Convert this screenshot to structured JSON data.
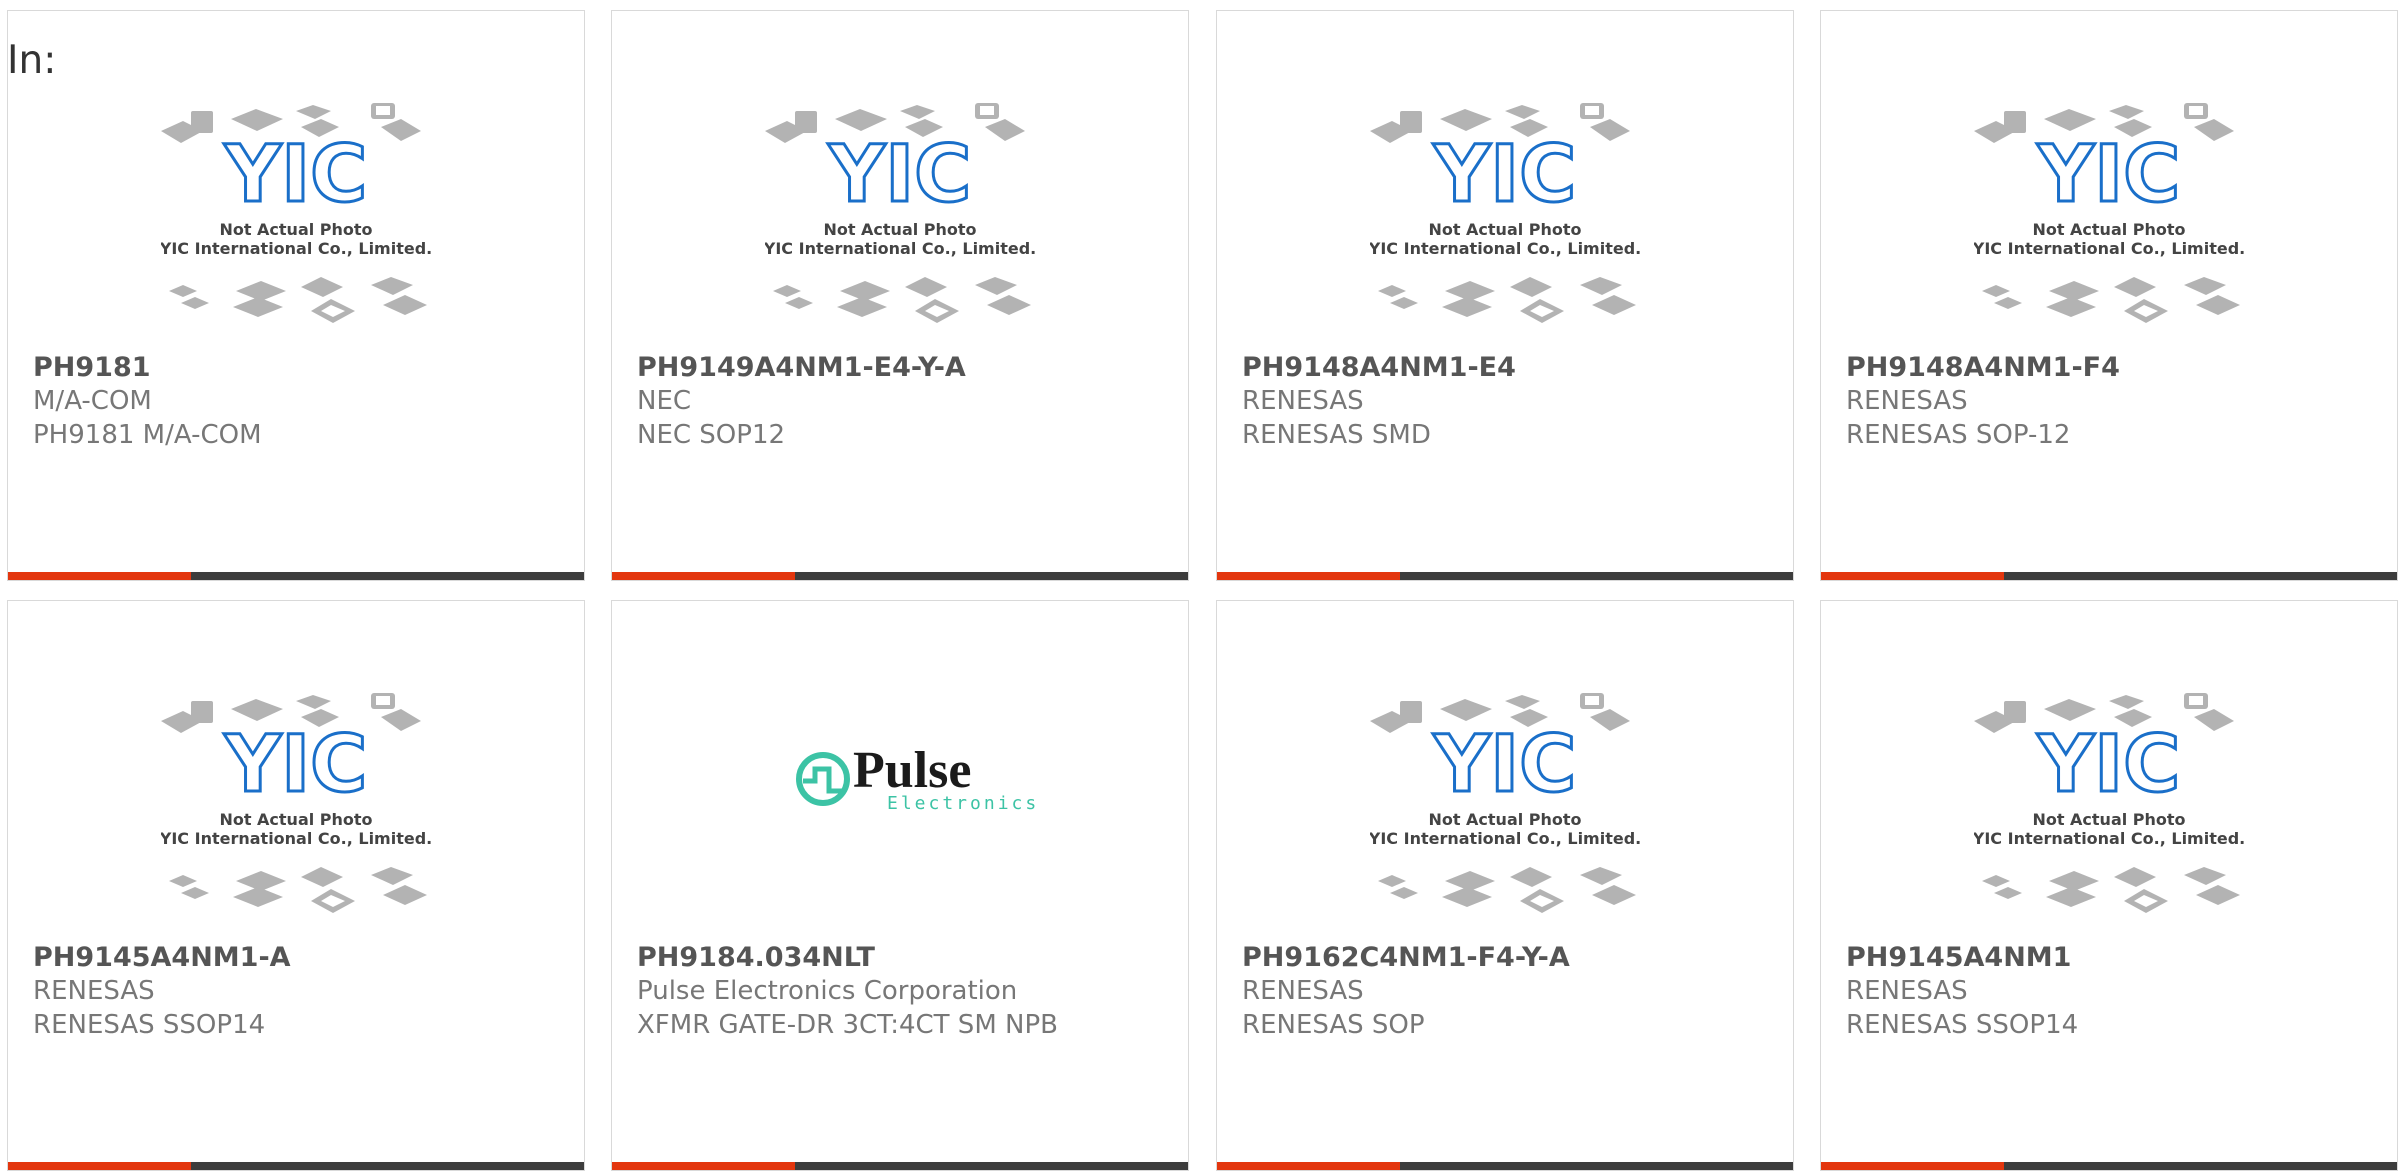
{
  "header": {
    "label": "In:"
  },
  "colors": {
    "accent": "#e3360e",
    "bar": "#3d3d3d",
    "yic_blue": "#1a6fc9",
    "pulse_teal": "#3cc3a5"
  },
  "placeholder": {
    "line1": "Not Actual Photo",
    "line2": "YIC International Co., Limited.",
    "logo_text": "YIC"
  },
  "pulse_logo": {
    "name": "Pulse",
    "sub": "Electronics"
  },
  "products": [
    {
      "part": "PH9181",
      "manufacturer": "M/A-COM",
      "description": "PH9181 M/A-COM",
      "image": "yic-placeholder"
    },
    {
      "part": "PH9149A4NM1-E4-Y-A",
      "manufacturer": "NEC",
      "description": "NEC SOP12",
      "image": "yic-placeholder"
    },
    {
      "part": "PH9148A4NM1-E4",
      "manufacturer": "RENESAS",
      "description": "RENESAS SMD",
      "image": "yic-placeholder"
    },
    {
      "part": "PH9148A4NM1-F4",
      "manufacturer": "RENESAS",
      "description": "RENESAS SOP-12",
      "image": "yic-placeholder"
    },
    {
      "part": "PH9145A4NM1-A",
      "manufacturer": "RENESAS",
      "description": "RENESAS SSOP14",
      "image": "yic-placeholder"
    },
    {
      "part": "PH9184.034NLT",
      "manufacturer": "Pulse Electronics Corporation",
      "description": "XFMR GATE-DR 3CT:4CT SM NPB",
      "image": "pulse-logo"
    },
    {
      "part": "PH9162C4NM1-F4-Y-A",
      "manufacturer": "RENESAS",
      "description": "RENESAS SOP",
      "image": "yic-placeholder"
    },
    {
      "part": "PH9145A4NM1",
      "manufacturer": "RENESAS",
      "description": "RENESAS SSOP14",
      "image": "yic-placeholder"
    }
  ]
}
